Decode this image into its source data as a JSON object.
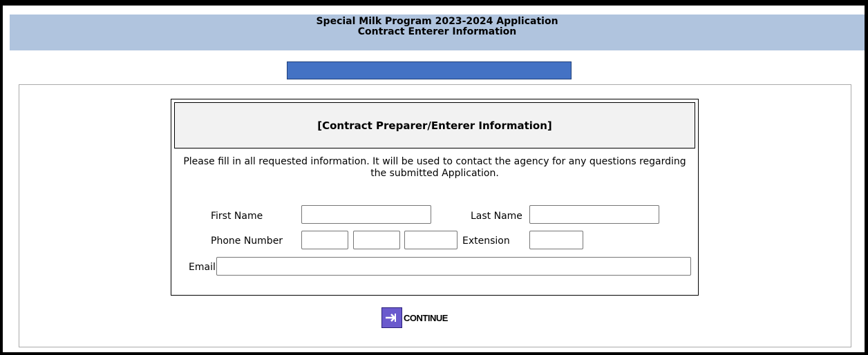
{
  "header": {
    "line1": "Special Milk Program 2023-2024 Application",
    "line2": "Contract Enterer Information"
  },
  "form": {
    "title": "[Contract Preparer/Enterer Information]",
    "instructions": "Please fill in all requested information. It will be used to contact the agency for any questions regarding the submitted Application.",
    "fields": {
      "first_name_label": "First Name",
      "last_name_label": "Last Name",
      "phone_label": "Phone Number",
      "extension_label": "Extension",
      "email_label": "Email"
    },
    "values": {
      "first_name": "",
      "last_name": "",
      "phone_area": "",
      "phone_prefix": "",
      "phone_line": "",
      "extension": "",
      "email": ""
    }
  },
  "continue": {
    "label": "CONTINUE",
    "icon": "arrow-right-icon"
  },
  "colors": {
    "header_bg": "#b0c4de",
    "progress_bar": "#4472c4",
    "continue_icon": "#6a5acd"
  }
}
